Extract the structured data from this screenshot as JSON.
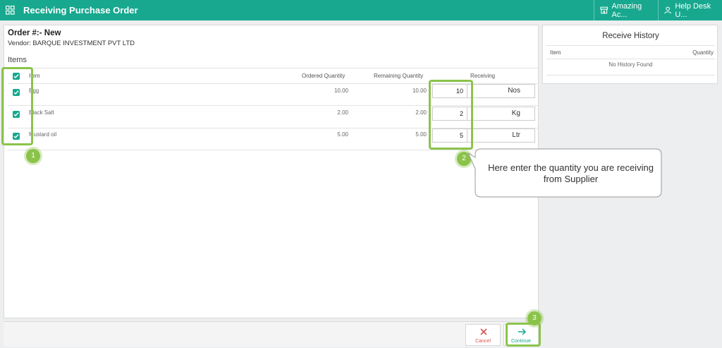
{
  "header": {
    "title": "Receiving Purchase Order",
    "account_label": "Amazing Ac...",
    "help_label": "Help Desk U..."
  },
  "order": {
    "title": "Order #:- New",
    "vendor": "Vendor: BARQUE INVESTMENT PVT LTD"
  },
  "items": {
    "section_title": "Items",
    "columns": {
      "item": "Item",
      "ordered": "Ordered Quantity",
      "remaining": "Remaining Quantity",
      "receiving": "Receiving"
    },
    "rows": [
      {
        "name": "Egg",
        "ordered": "10.00",
        "remaining": "10.00",
        "receiving": "10",
        "unit": "Nos",
        "checked": true
      },
      {
        "name": "Black Salt",
        "ordered": "2.00",
        "remaining": "2.00",
        "receiving": "2",
        "unit": "Kg",
        "checked": true
      },
      {
        "name": "Mustard oil",
        "ordered": "5.00",
        "remaining": "5.00",
        "receiving": "5",
        "unit": "Ltr",
        "checked": true
      }
    ]
  },
  "history": {
    "title": "Receive History",
    "col_item": "Item",
    "col_qty": "Quantity",
    "empty": "No History Found"
  },
  "actions": {
    "cancel": "Cancel",
    "continue": "Continue"
  },
  "annotations": {
    "badge1": "1",
    "badge2": "2",
    "badge3": "3",
    "callout": "Here enter the quantity you are receiving from Supplier"
  },
  "colors": {
    "brand": "#17a88f",
    "highlight": "#8bc34a",
    "cancel": "#d9534f"
  }
}
